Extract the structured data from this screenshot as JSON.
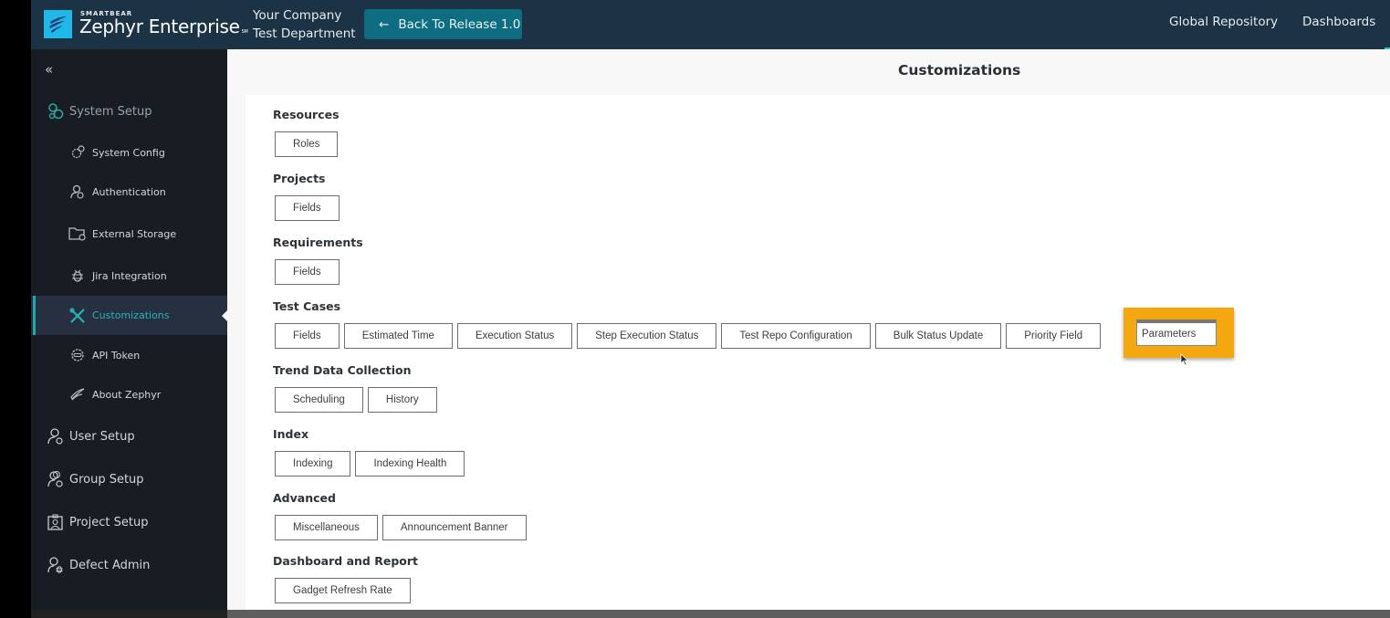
{
  "header": {
    "brand_small": "SMARTBEAR",
    "brand_main": "Zephyr Enterprise",
    "brand_mark": "SM",
    "company": "Your Company",
    "department": "Test Department",
    "back_button": "Back To Release 1.0",
    "nav": [
      "Global Repository",
      "Dashboards"
    ]
  },
  "sidebar": {
    "collapse_icon": "«",
    "sections": [
      {
        "label": "System Setup",
        "icon": "gears-icon"
      },
      {
        "label": "User Setup",
        "icon": "user-gear-icon"
      },
      {
        "label": "Group Setup",
        "icon": "group-gear-icon"
      },
      {
        "label": "Project Setup",
        "icon": "project-icon"
      },
      {
        "label": "Defect Admin",
        "icon": "user-bug-icon"
      }
    ],
    "sub_items": [
      {
        "label": "System Config",
        "icon": "gear-icon"
      },
      {
        "label": "Authentication",
        "icon": "user-check-icon"
      },
      {
        "label": "External Storage",
        "icon": "folder-gear-icon"
      },
      {
        "label": "Jira Integration",
        "icon": "bug-icon"
      },
      {
        "label": "Customizations",
        "icon": "tools-icon",
        "active": true
      },
      {
        "label": "API Token",
        "icon": "gear-token-icon"
      },
      {
        "label": "About Zephyr",
        "icon": "wing-icon"
      }
    ]
  },
  "main": {
    "title": "Customizations",
    "sections": [
      {
        "title": "Resources",
        "buttons": [
          "Roles"
        ]
      },
      {
        "title": "Projects",
        "buttons": [
          "Fields"
        ]
      },
      {
        "title": "Requirements",
        "buttons": [
          "Fields"
        ]
      },
      {
        "title": "Test Cases",
        "buttons": [
          "Fields",
          "Estimated Time",
          "Execution Status",
          "Step Execution Status",
          "Test Repo Configuration",
          "Bulk Status Update",
          "Priority Field",
          "Parameters"
        ]
      },
      {
        "title": "Trend Data Collection",
        "buttons": [
          "Scheduling",
          "History"
        ]
      },
      {
        "title": "Index",
        "buttons": [
          "Indexing",
          "Indexing Health"
        ]
      },
      {
        "title": "Advanced",
        "buttons": [
          "Miscellaneous",
          "Announcement Banner"
        ]
      },
      {
        "title": "Dashboard and Report",
        "buttons": [
          "Gadget Refresh Rate"
        ]
      }
    ],
    "highlighted_button": "Parameters"
  },
  "colors": {
    "topbar": "#1b3345",
    "sidebar": "#181c23",
    "accent_teal": "#27b4b4",
    "back_button": "#0e6d80",
    "highlight": "#f5a70f"
  }
}
